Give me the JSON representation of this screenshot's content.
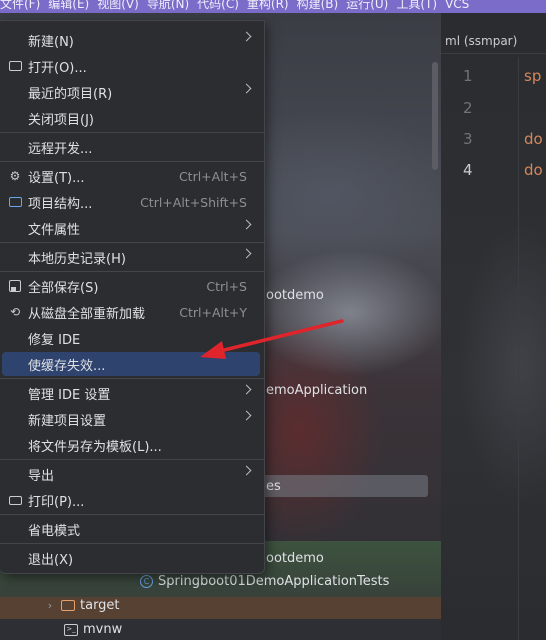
{
  "menubar": {
    "items": [
      "文件(F)",
      "编辑(E)",
      "视图(V)",
      "导航(N)",
      "代码(C)",
      "重构(R)",
      "构建(B)",
      "运行(U)",
      "工具(T)",
      "VCS"
    ]
  },
  "project_tree": {
    "partial_1": "ootdemo",
    "partial_2": "emoApplication",
    "partial_3": "es",
    "partial_4": "ootdemo",
    "test_class": "Springboot01DemoApplicationTests",
    "folder_target": "target",
    "file_mvnw": "mvnw"
  },
  "editor": {
    "tab_label": "ml (ssmpar)",
    "lines": [
      {
        "no": "1",
        "code": "sp"
      },
      {
        "no": "2",
        "code": ""
      },
      {
        "no": "3",
        "code": "do"
      },
      {
        "no": "4",
        "code": "do"
      }
    ]
  },
  "menu": {
    "items": [
      {
        "label": "新建(N)",
        "shortcut": "",
        "submenu": true,
        "icon": ""
      },
      {
        "label": "打开(O)...",
        "shortcut": "",
        "submenu": false,
        "icon": "folder-icon"
      },
      {
        "label": "最近的项目(R)",
        "shortcut": "",
        "submenu": true,
        "icon": ""
      },
      {
        "label": "关闭项目(J)",
        "shortcut": "",
        "submenu": false,
        "icon": ""
      },
      {
        "label": "远程开发...",
        "shortcut": "",
        "submenu": false,
        "icon": ""
      },
      {
        "label": "设置(T)...",
        "shortcut": "Ctrl+Alt+S",
        "submenu": false,
        "icon": "gear-icon"
      },
      {
        "label": "项目结构...",
        "shortcut": "Ctrl+Alt+Shift+S",
        "submenu": false,
        "icon": "project-structure-icon"
      },
      {
        "label": "文件属性",
        "shortcut": "",
        "submenu": true,
        "icon": ""
      },
      {
        "label": "本地历史记录(H)",
        "shortcut": "",
        "submenu": true,
        "icon": ""
      },
      {
        "label": "全部保存(S)",
        "shortcut": "Ctrl+S",
        "submenu": false,
        "icon": "save-icon"
      },
      {
        "label": "从磁盘全部重新加载",
        "shortcut": "Ctrl+Alt+Y",
        "submenu": false,
        "icon": "reload-icon"
      },
      {
        "label": "修复 IDE",
        "shortcut": "",
        "submenu": false,
        "icon": ""
      },
      {
        "label": "使缓存失效...",
        "shortcut": "",
        "submenu": false,
        "icon": "",
        "selected": true
      },
      {
        "label": "管理 IDE 设置",
        "shortcut": "",
        "submenu": true,
        "icon": ""
      },
      {
        "label": "新建项目设置",
        "shortcut": "",
        "submenu": true,
        "icon": ""
      },
      {
        "label": "将文件另存为模板(L)...",
        "shortcut": "",
        "submenu": false,
        "icon": ""
      },
      {
        "label": "导出",
        "shortcut": "",
        "submenu": true,
        "icon": ""
      },
      {
        "label": "打印(P)...",
        "shortcut": "",
        "submenu": false,
        "icon": "print-icon"
      },
      {
        "label": "省电模式",
        "shortcut": "",
        "submenu": false,
        "icon": ""
      },
      {
        "label": "退出(X)",
        "shortcut": "",
        "submenu": false,
        "icon": ""
      }
    ]
  },
  "colors": {
    "menu_bg": "#2b2d30",
    "selection": "#2e436e",
    "annotation_arrow": "#e0242c",
    "menubar": "#7a6cc8"
  }
}
